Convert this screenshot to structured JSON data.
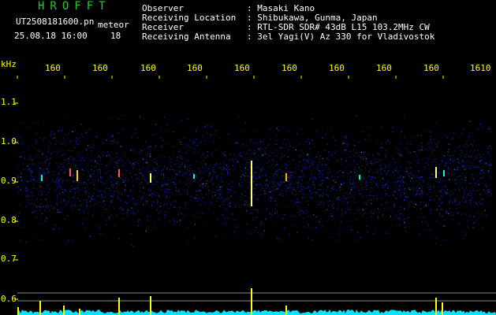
{
  "app": {
    "title": "HROFFT"
  },
  "file": {
    "name": "UT2508181600.pn",
    "tag": "meteor",
    "date": "25.08.18 16:00",
    "count": "18"
  },
  "info": [
    {
      "label": "Observer",
      "value": ": Masaki Kano"
    },
    {
      "label": "Receiving Location",
      "value": ": Shibukawa, Gunma, Japan"
    },
    {
      "label": "Receiver",
      "value": ": RTL-SDR SDR# 43dB L15 103.2MHz CW"
    },
    {
      "label": "Receiving Antenna",
      "value": ": 3el Yagi(V) Az 330 for Vladivostok"
    }
  ],
  "axis": {
    "unit": "kHz",
    "y_ticks": [
      "1.1",
      "1.0",
      "0.9",
      "0.8",
      "0.7",
      "0.6"
    ],
    "x_ticks": [
      "160",
      "160",
      "160",
      "160",
      "160",
      "160",
      "160",
      "160",
      "160",
      "1610"
    ]
  },
  "colors": {
    "background": "#000000",
    "label": "#ffff00",
    "title": "#22cc22",
    "text": "#ffffff",
    "band": "#1a2cff",
    "strip": "#00e5ff",
    "spike": "#ffff00"
  }
}
